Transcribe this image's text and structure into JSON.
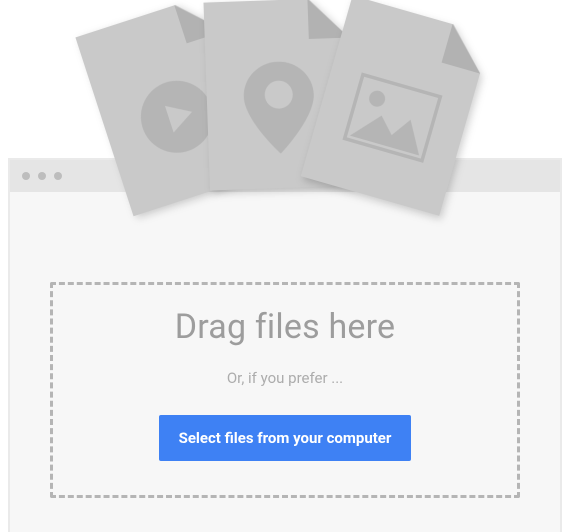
{
  "dropzone": {
    "heading": "Drag files here",
    "subtext": "Or, if you prefer ...",
    "button_label": "Select files from your computer"
  },
  "icons": {
    "file_play": "play-icon",
    "file_pin": "location-pin-icon",
    "file_image": "image-icon"
  },
  "colors": {
    "button_bg": "#3e81f4",
    "dashed_border": "#b5b5b5",
    "heading_text": "#9d9d9d"
  }
}
